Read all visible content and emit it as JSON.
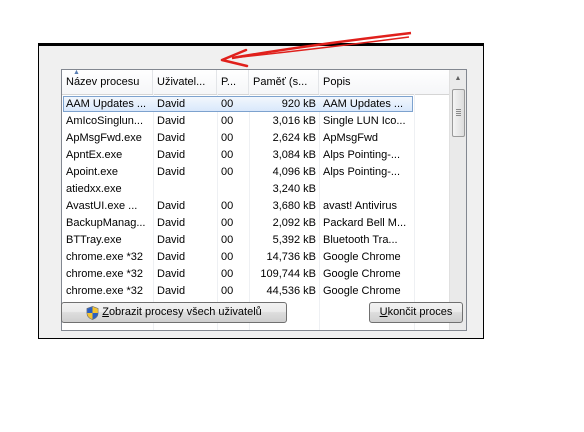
{
  "table": {
    "columns": [
      "Název procesu",
      "Uživatel...",
      "P...",
      "Paměť (s...",
      "Popis"
    ],
    "rows": [
      [
        "AAM Updates ...",
        "David",
        "00",
        "920 kB",
        "AAM Updates ..."
      ],
      [
        "AmIcoSinglun...",
        "David",
        "00",
        "3,016 kB",
        "Single LUN Ico..."
      ],
      [
        "ApMsgFwd.exe",
        "David",
        "00",
        "2,624 kB",
        "ApMsgFwd"
      ],
      [
        "ApntEx.exe",
        "David",
        "00",
        "3,084 kB",
        "Alps Pointing-..."
      ],
      [
        "Apoint.exe",
        "David",
        "00",
        "4,096 kB",
        "Alps Pointing-..."
      ],
      [
        "atiedxx.exe",
        "",
        "",
        "3,240 kB",
        ""
      ],
      [
        "AvastUI.exe ...",
        "David",
        "00",
        "3,680 kB",
        "avast! Antivirus"
      ],
      [
        "BackupManag...",
        "David",
        "00",
        "2,092 kB",
        "Packard Bell M..."
      ],
      [
        "BTTray.exe",
        "David",
        "00",
        "5,392 kB",
        "Bluetooth Tra..."
      ],
      [
        "chrome.exe *32",
        "David",
        "00",
        "14,736 kB",
        "Google Chrome"
      ],
      [
        "chrome.exe *32",
        "David",
        "00",
        "109,744 kB",
        "Google Chrome"
      ],
      [
        "chrome.exe *32",
        "David",
        "00",
        "44,536 kB",
        "Google Chrome"
      ]
    ],
    "selected_index": 0
  },
  "buttons": {
    "show_all_pre": "Z",
    "show_all_rest": "obrazit procesy všech uživatelů",
    "end_pre": "U",
    "end_rest": "končit proces"
  },
  "colors": {
    "selection": "#d9e8fb",
    "annotation_arrow": "#e0201c"
  },
  "icons": {
    "shield": "uac-shield-icon",
    "sort": "sort-ascending-icon"
  }
}
